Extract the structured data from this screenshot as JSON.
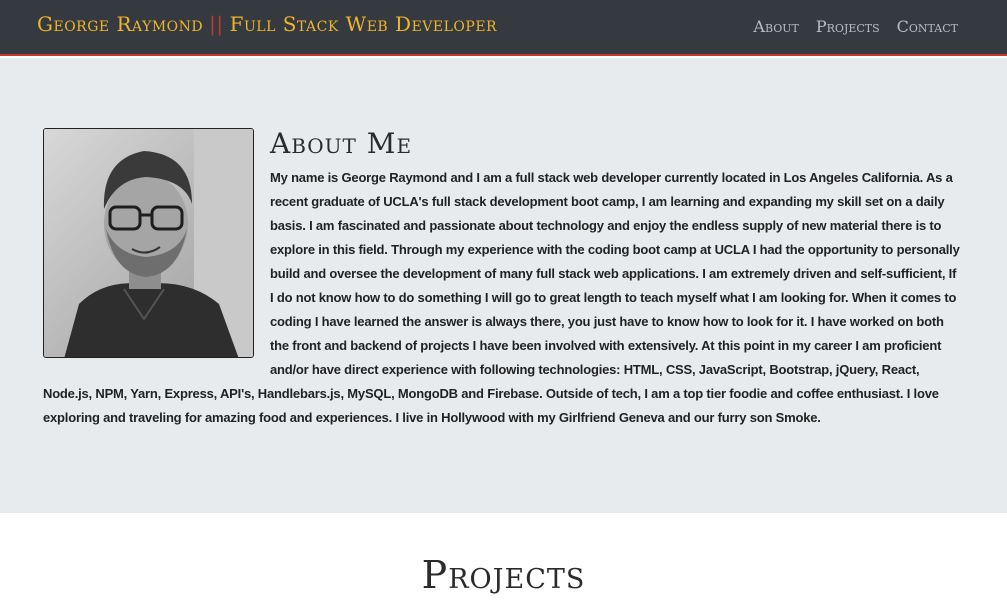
{
  "nav": {
    "brand_name": "George Raymond",
    "brand_separator": "||",
    "brand_role": "Full Stack Web Developer",
    "links": [
      "About",
      "Projects",
      "Contact"
    ]
  },
  "about": {
    "title": "About Me",
    "text": "My name is George Raymond and I am a full stack web developer currently located in Los Angeles California. As a recent graduate of UCLA's full stack development boot camp, I am learning and expanding my skill set on a daily basis. I am fascinated and passionate about technology and enjoy the endless supply of new material there is to explore in this field. Through my experience with the coding boot camp at UCLA I had the opportunity to personally build and oversee the development of many full stack web applications. I am extremely driven and self-sufficient, If I do not know how to do something I will go to great length to teach myself what I am looking for. When it comes to coding I have learned the answer is always there, you just have to know how to look for it. I have worked on both the front and backend of projects I have been involved with extensively. At this point in my career I am proficient and/or have direct experience with following technologies: HTML, CSS, JavaScript, Bootstrap, jQuery, React, Node.js, NPM, Yarn, Express, API's, Handlebars.js, MySQL, MongoDB and Firebase. Outside of tech, I am a top tier foodie and coffee enthusiast. I love exploring and traveling for amazing food and experiences. I live in Hollywood with my Girlfriend Geneva and our furry son Smoke."
  },
  "projects": {
    "title": "Projects"
  },
  "colors": {
    "navbar_bg": "#343a40",
    "brand": "#f0b429",
    "separator": "#c0392b",
    "nav_link": "#b9bdc2",
    "about_bg": "#e8ebee"
  }
}
